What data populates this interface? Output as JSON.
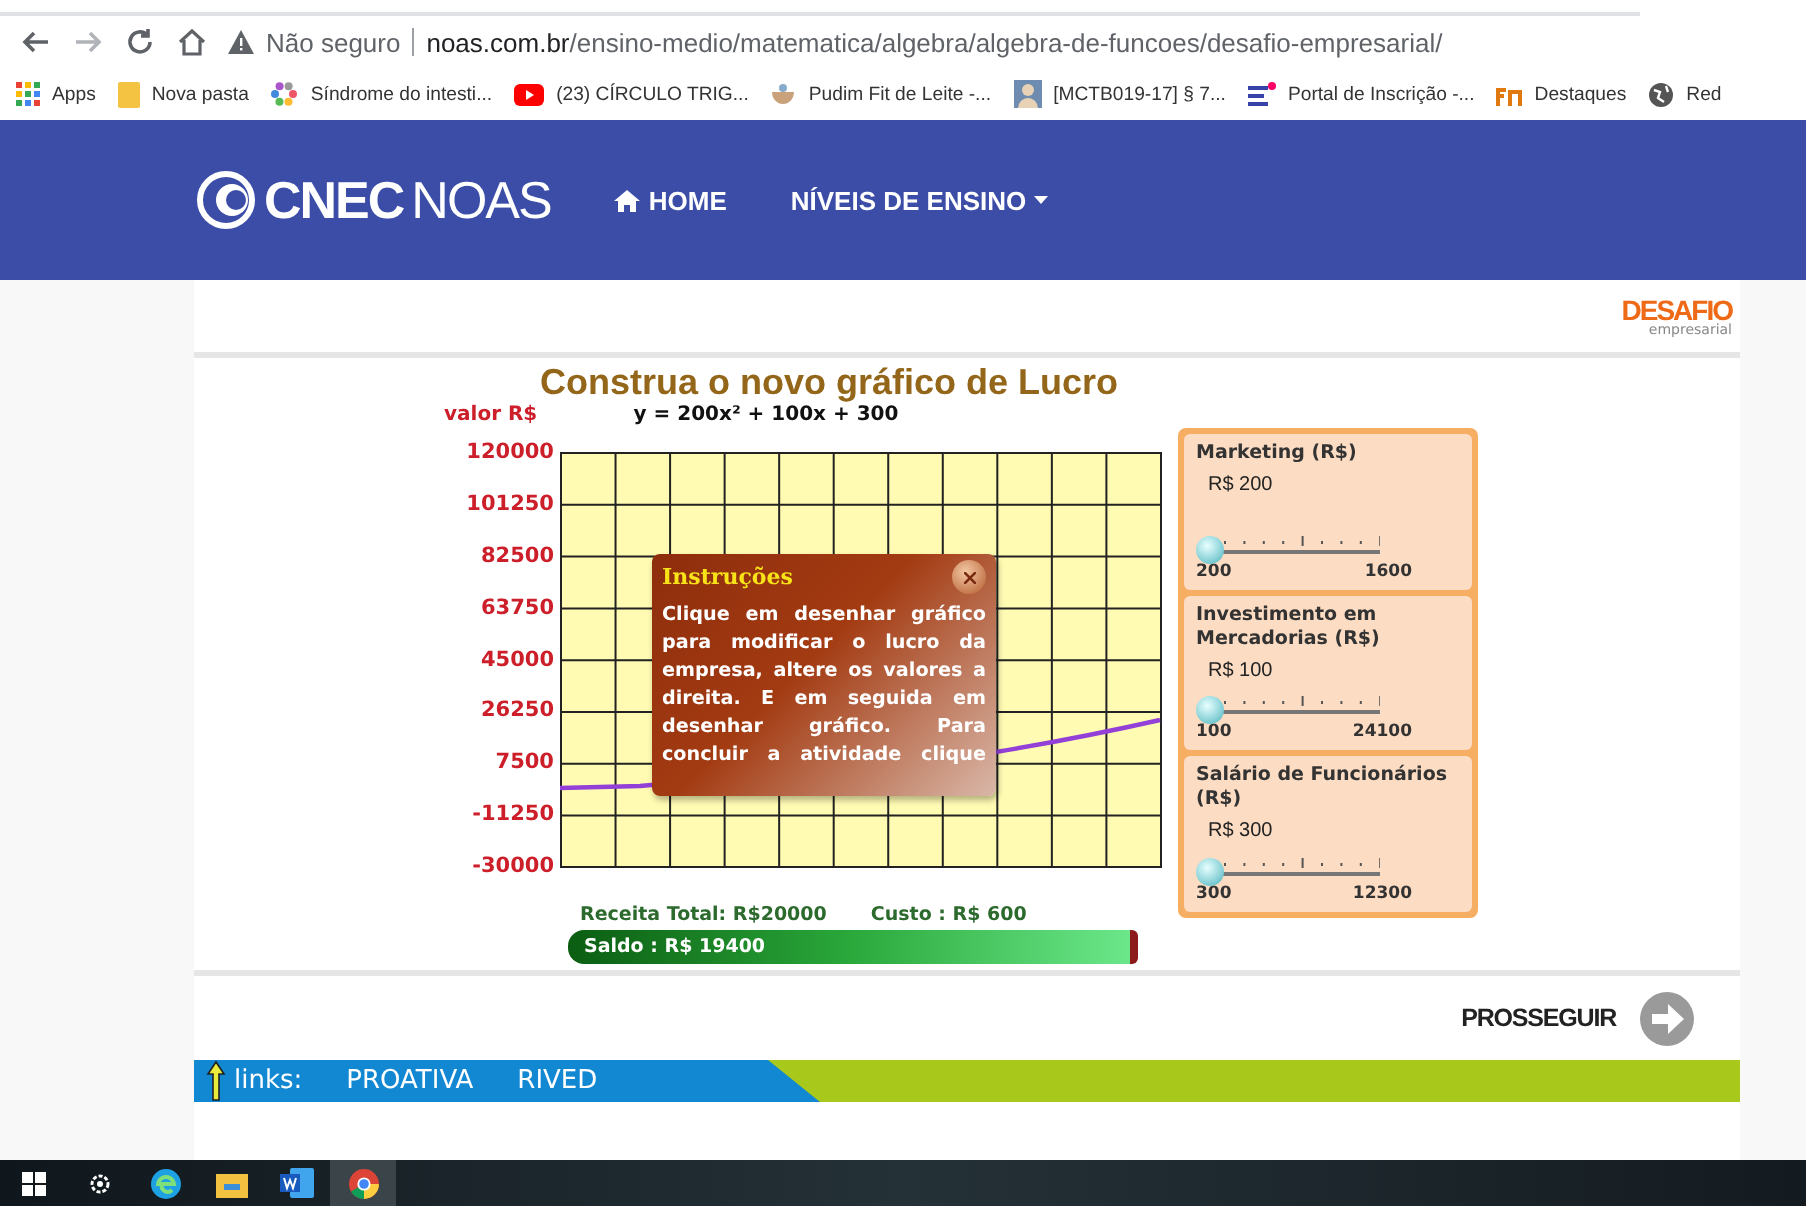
{
  "browser": {
    "security": "Não seguro",
    "domain": "noas.com.br",
    "path": "/ensino-medio/matematica/algebra/algebra-de-funcoes/desafio-empresarial/"
  },
  "bookmarks": [
    {
      "label": "Apps"
    },
    {
      "label": "Nova pasta"
    },
    {
      "label": "Síndrome do intesti..."
    },
    {
      "label": "(23) CÍRCULO TRIG..."
    },
    {
      "label": "Pudim Fit de Leite -..."
    },
    {
      "label": "[MCTB019-17] § 7..."
    },
    {
      "label": "Portal de Inscrição -..."
    },
    {
      "label": "Destaques"
    },
    {
      "label": "Red"
    }
  ],
  "nav": {
    "logo_bold": "CNEC",
    "logo_light": "NOAS",
    "items": [
      {
        "label": "HOME",
        "kind": "home"
      },
      {
        "label": "NÍVEIS DE ENSINO",
        "kind": "dropdown"
      }
    ]
  },
  "brand": {
    "name": "DESAFIO",
    "tagline": "empresarial"
  },
  "activity": {
    "title": "Construa o novo gráfico de Lucro",
    "graph": {
      "y_label": "valor R$",
      "equation": "y = 200x² + 100x + 300",
      "y_ticks": [
        "120000",
        "101250",
        "82500",
        "63750",
        "45000",
        "26250",
        "7500",
        "-11250",
        "-30000"
      ]
    },
    "instructions": {
      "title": "Instruções",
      "text": "Clique em desenhar gráfico para modificar o lucro da empresa, altere os valores a direita. E em seguida em desenhar gráfico. Para concluir a atividade clique"
    },
    "controls": [
      {
        "title": "Marketing (R$)",
        "value": "R$ 200",
        "min": "200",
        "max": "1600",
        "level": 0
      },
      {
        "title": "Investimento em Mercadorias (R$)",
        "value": "R$ 100",
        "min": "100",
        "max": "24100",
        "level": 0
      },
      {
        "title": "Salário de Funcionários (R$)",
        "value": "R$ 300",
        "min": "300",
        "max": "12300",
        "level": 0
      }
    ],
    "revenue": "Receita Total: R$20000",
    "cost": "Custo : R$ 600",
    "balance": "Saldo : R$ 19400"
  },
  "continue_button": "PROSSEGUIR",
  "links": {
    "label": "links:",
    "items": [
      "PROATIVA",
      "RIVED"
    ]
  },
  "taskbar": [
    {
      "selected": false
    },
    {
      "selected": false
    },
    {
      "selected": false
    },
    {
      "selected": false
    },
    {
      "selected": false
    },
    {
      "selected": true
    }
  ]
}
